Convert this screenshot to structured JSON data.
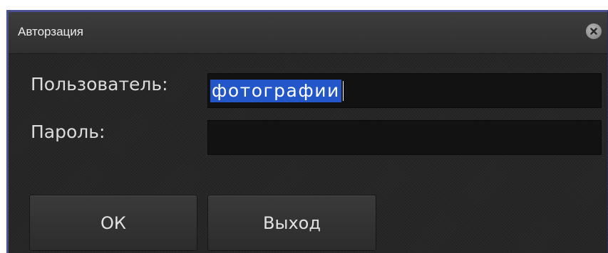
{
  "window": {
    "title": "Авторзация",
    "close_icon": "close-icon",
    "border_color": "#4a4f96"
  },
  "form": {
    "username_label": "Пользователь:",
    "username_value": "фотографии",
    "password_label": "Пароль:",
    "password_value": "",
    "selection_color": "#2357c9"
  },
  "buttons": {
    "ok_label": "ОК",
    "exit_label": "Выход"
  }
}
